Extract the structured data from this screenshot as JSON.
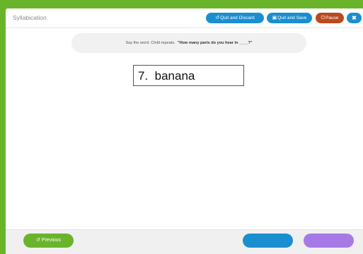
{
  "header": {
    "title": "Syllabication",
    "buttons": {
      "quit_discard": {
        "label": "Quit and Discard",
        "icon": "undo-icon"
      },
      "quit_save": {
        "label": "Quit and Save",
        "icon": "save-icon"
      },
      "pause": {
        "label": "Pause",
        "icon": "power-icon"
      },
      "close": {
        "icon": "close-icon"
      }
    }
  },
  "instruction": {
    "lead": "Say the word.  Child repeats.",
    "question": "\"How many parts do you hear in ____?\""
  },
  "item": {
    "number": "7.",
    "word": "banana"
  },
  "footer": {
    "previous_label": "Previous",
    "previous_icon": "undo-icon"
  },
  "colors": {
    "frame": "#6ab42c",
    "primary": "#1a8fcf",
    "pause": "#b94a1f",
    "purple": "#a779e6"
  }
}
